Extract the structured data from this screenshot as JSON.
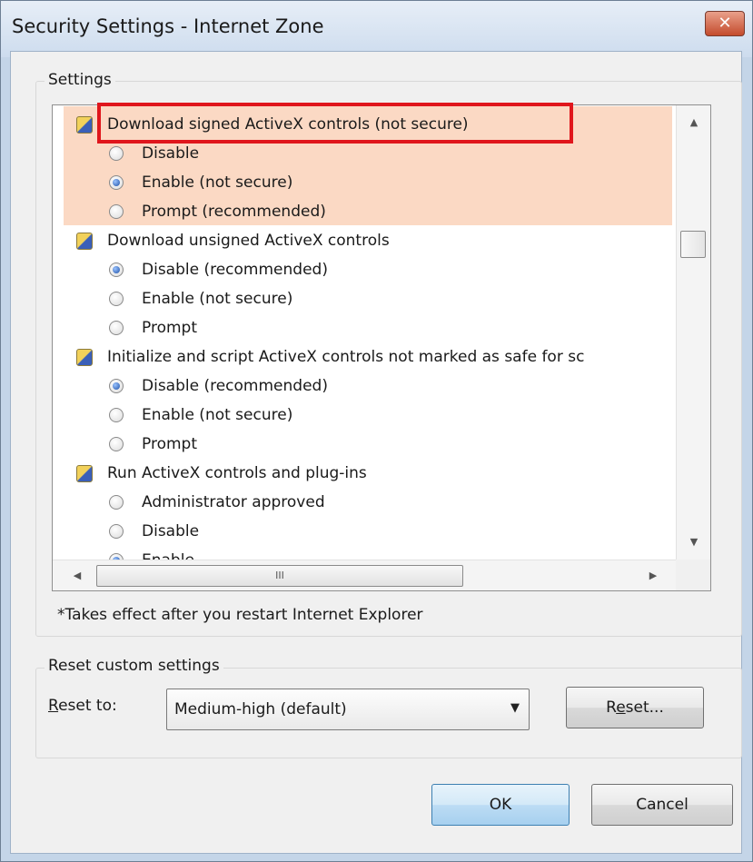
{
  "window": {
    "title": "Security Settings - Internet Zone",
    "close_glyph": "✕"
  },
  "settings_group": {
    "label": "Settings"
  },
  "list": {
    "items": [
      {
        "type": "header",
        "label": "Download signed ActiveX controls (not secure)",
        "highlighted": true
      },
      {
        "type": "option",
        "label": "Disable",
        "checked": false,
        "highlighted": true
      },
      {
        "type": "option",
        "label": "Enable (not secure)",
        "checked": true,
        "highlighted": true
      },
      {
        "type": "option",
        "label": "Prompt (recommended)",
        "checked": false,
        "highlighted": true
      },
      {
        "type": "header",
        "label": "Download unsigned ActiveX controls"
      },
      {
        "type": "option",
        "label": "Disable (recommended)",
        "checked": true
      },
      {
        "type": "option",
        "label": "Enable (not secure)",
        "checked": false
      },
      {
        "type": "option",
        "label": "Prompt",
        "checked": false
      },
      {
        "type": "header",
        "label": "Initialize and script ActiveX controls not marked as safe for sc"
      },
      {
        "type": "option",
        "label": "Disable (recommended)",
        "checked": true
      },
      {
        "type": "option",
        "label": "Enable (not secure)",
        "checked": false
      },
      {
        "type": "option",
        "label": "Prompt",
        "checked": false
      },
      {
        "type": "header",
        "label": "Run ActiveX controls and plug-ins"
      },
      {
        "type": "option",
        "label": "Administrator approved",
        "checked": false
      },
      {
        "type": "option",
        "label": "Disable",
        "checked": false
      },
      {
        "type": "option",
        "label": "Enable",
        "checked": true
      }
    ],
    "hscroll_grip": "III"
  },
  "note": "*Takes effect after you restart Internet Explorer",
  "reset_group": {
    "label": "Reset custom settings",
    "reset_to_label": "Reset to:",
    "reset_to_mnemonic": "R",
    "reset_to_rest": "eset to:",
    "select_value": "Medium-high (default)",
    "reset_button": "Reset...",
    "reset_button_pre": "R",
    "reset_button_mnemonic": "e",
    "reset_button_post": "set..."
  },
  "footer": {
    "ok": "OK",
    "cancel": "Cancel"
  },
  "colors": {
    "highlight": "#fbd9c4",
    "annotation_red": "#e0161c",
    "titlebar": "#cddcee"
  }
}
